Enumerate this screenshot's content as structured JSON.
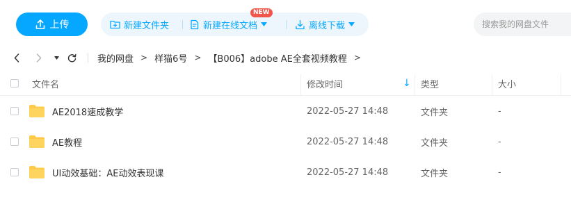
{
  "toolbar": {
    "upload_label": "上传",
    "new_folder_label": "新建文件夹",
    "new_online_doc_label": "新建在线文档",
    "new_badge": "NEW",
    "offline_download_label": "离线下载",
    "search_placeholder": "搜索我的网盘文件"
  },
  "nav": {
    "breadcrumbs": [
      "我的网盘",
      "样猫6号",
      "【B006】adobe AE全套视频教程"
    ],
    "separator": ">"
  },
  "table": {
    "headers": {
      "name": "文件名",
      "modified": "修改时间",
      "type": "类型",
      "size": "大小"
    },
    "sort_indicator": "↓",
    "rows": [
      {
        "name": "AE2018速成教学",
        "modified": "2022-05-27 14:48",
        "type": "文件夹",
        "size": "-"
      },
      {
        "name": "AE教程",
        "modified": "2022-05-27 14:48",
        "type": "文件夹",
        "size": "-"
      },
      {
        "name": "UI动效基础：AE动效表现课",
        "modified": "2022-05-27 14:48",
        "type": "文件夹",
        "size": "-"
      }
    ]
  },
  "colors": {
    "accent": "#06a7ff",
    "badge": "#f2564a",
    "folder": "#ffc94a"
  },
  "icons": [
    "upload-icon",
    "new-folder-icon",
    "new-doc-icon",
    "download-icon",
    "back-icon",
    "forward-icon",
    "refresh-icon",
    "folder-icon"
  ]
}
